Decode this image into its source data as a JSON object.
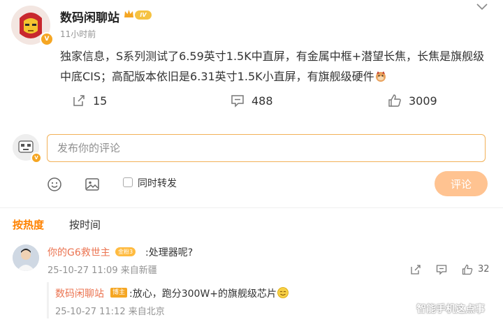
{
  "post": {
    "username": "数码闲聊站",
    "level": "IV",
    "verified_badge": "V",
    "time": "11小时前",
    "text": "独家信息，S系列测试了6.59英寸1.5K中直屏，有金属中框+潜望长焦，长焦是旗舰级中底CIS；高配版本依旧是6.31英寸1.5K小直屏，有旗舰级硬件",
    "text_emoji": "doge-emoji"
  },
  "stats": {
    "reposts": "15",
    "comments": "488",
    "likes": "3009"
  },
  "composer": {
    "placeholder": "发布你的评论",
    "repost_label": "同时转发",
    "submit_label": "评论"
  },
  "sort": {
    "hot": "按热度",
    "time": "按时间"
  },
  "comments": [
    {
      "user": "你的G6救世主",
      "fan_badge": "金粉3",
      "text": ":处理器呢?",
      "meta": "25-10-27 11:09 来自新疆",
      "likes": "32",
      "reply": {
        "user": "数码闲聊站",
        "badge": "博主",
        "text": ":放心，跑分300W+的旗舰级芯片",
        "meta": "25-10-27 11:12 来自北京"
      }
    }
  ],
  "watermark": "智能手机这点事",
  "colors": {
    "accent": "#ff8200",
    "username_link": "#eb7350",
    "input_border": "#f2b157",
    "submit_bg": "#ffc391"
  }
}
